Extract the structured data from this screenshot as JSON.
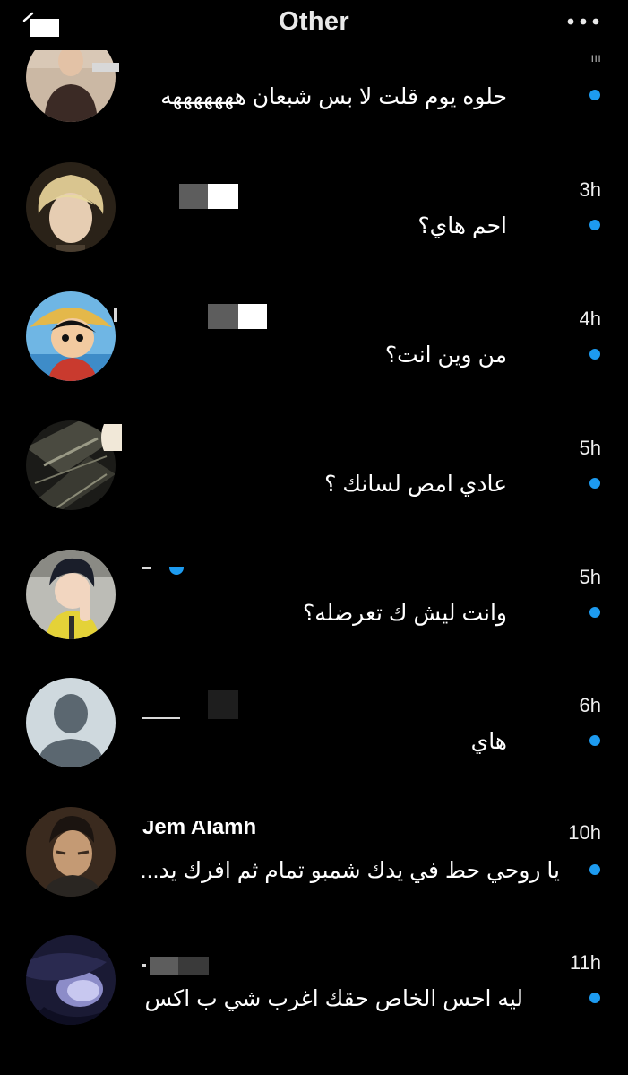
{
  "header": {
    "title": "Other",
    "back_icon": "back-icon",
    "more_icon": "more-icon"
  },
  "conversations": [
    {
      "message": "حلوه يوم قلت لا بس شبعان هههههههه",
      "time": "",
      "unread": true
    },
    {
      "message": "احم هاي؟",
      "time": "3h",
      "unread": true
    },
    {
      "message": "من وين انت؟",
      "time": "4h",
      "unread": true
    },
    {
      "message": "عادي امص لسانك ؟",
      "time": "5h",
      "unread": true
    },
    {
      "message": "وانت ليش ك تعرضله؟",
      "time": "5h",
      "unread": true
    },
    {
      "message": "هاي",
      "time": "6h",
      "unread": true
    },
    {
      "name": "Jem Alamh",
      "message": "يا روحي حط في يدك شمبو تمام ثم افرك يد...",
      "time": "10h",
      "unread": true
    },
    {
      "message": "ليه احس الخاص حقك اغرب شي ب اكس",
      "time": "11h",
      "unread": true
    }
  ],
  "colors": {
    "background": "#000000",
    "unread_dot": "#1d9bf0",
    "text": "#ffffff"
  }
}
